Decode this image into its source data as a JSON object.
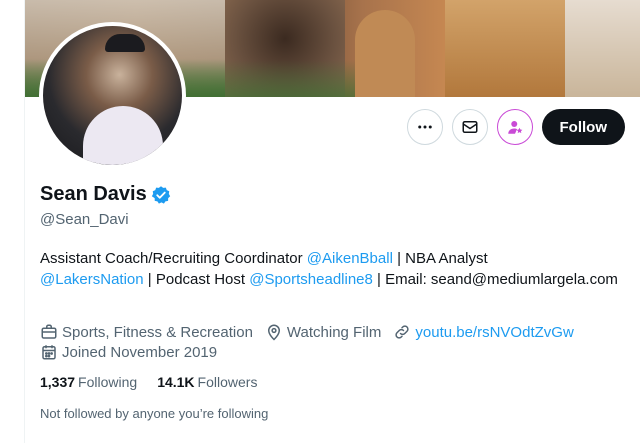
{
  "profile": {
    "display_name": "Sean Davis",
    "handle": "@Sean_Davi",
    "verified_icon": "verified-badge-icon"
  },
  "actions": {
    "more_icon": "more-icon",
    "message_icon": "envelope-icon",
    "subscribe_icon": "person-star-icon",
    "follow_label": "Follow"
  },
  "bio": {
    "segments": [
      {
        "text": "Assistant Coach/Recruiting Coordinator ",
        "type": "text"
      },
      {
        "text": "@AikenBball",
        "type": "link"
      },
      {
        "text": " | NBA Analyst ",
        "type": "text"
      },
      {
        "text": "@LakersNation",
        "type": "link"
      },
      {
        "text": " | Podcast Host ",
        "type": "text"
      },
      {
        "text": "@Sportsheadline8",
        "type": "link"
      },
      {
        "text": " | Email: seand@mediumlargela.com",
        "type": "text"
      }
    ]
  },
  "meta": {
    "category": "Sports, Fitness & Recreation",
    "location": "Watching Film",
    "website": "youtu.be/rsNVOdtZvGw",
    "joined": "Joined November 2019"
  },
  "counts": {
    "following_value": "1,337",
    "following_label": "Following",
    "followers_value": "14.1K",
    "followers_label": "Followers"
  },
  "followed_note": "Not followed by anyone you’re following",
  "colors": {
    "accent": "#1d9bf0",
    "text_primary": "#0f1419",
    "text_secondary": "#536471",
    "subscribe_accent": "#c94ad6"
  }
}
